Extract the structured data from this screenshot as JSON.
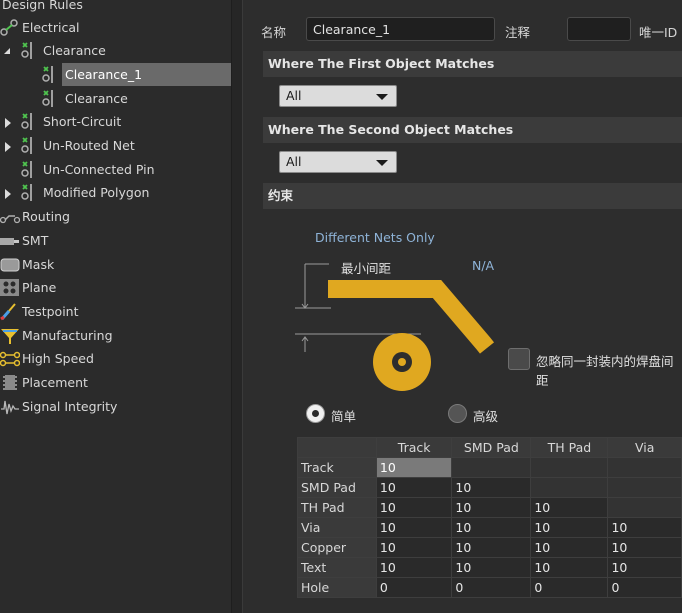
{
  "tree": {
    "root_label": "Design Rules",
    "items": [
      {
        "label": "Electrical",
        "icon": "electrical-rule-icon"
      },
      {
        "label": "Clearance",
        "icon": "clearance-rule-icon",
        "expanded": true
      },
      {
        "label": "Clearance_1",
        "icon": "clearance-rule-icon",
        "selected": true
      },
      {
        "label": "Clearance",
        "icon": "clearance-rule-icon"
      },
      {
        "label": "Short-Circuit",
        "icon": "short-circuit-rule-icon"
      },
      {
        "label": "Un-Routed Net",
        "icon": "unrouted-net-rule-icon"
      },
      {
        "label": "Un-Connected Pin",
        "icon": "unconnected-pin-rule-icon"
      },
      {
        "label": "Modified Polygon",
        "icon": "modified-polygon-rule-icon"
      },
      {
        "label": "Routing",
        "icon": "routing-icon"
      },
      {
        "label": "SMT",
        "icon": "smt-icon"
      },
      {
        "label": "Mask",
        "icon": "mask-icon"
      },
      {
        "label": "Plane",
        "icon": "plane-icon"
      },
      {
        "label": "Testpoint",
        "icon": "testpoint-icon"
      },
      {
        "label": "Manufacturing",
        "icon": "manufacturing-icon"
      },
      {
        "label": "High Speed",
        "icon": "high-speed-icon"
      },
      {
        "label": "Placement",
        "icon": "placement-icon"
      },
      {
        "label": "Signal Integrity",
        "icon": "signal-integrity-icon"
      }
    ]
  },
  "rule": {
    "name_label": "名称",
    "name_value": "Clearance_1",
    "comment_label": "注释",
    "comment_value": "",
    "uid_label": "唯一ID"
  },
  "first_match": {
    "header": "Where The First Object Matches",
    "selected": "All"
  },
  "second_match": {
    "header": "Where The Second Object Matches",
    "selected": "All"
  },
  "constraints": {
    "header": "约束",
    "net_scope": "Different Nets Only",
    "min_clearance_label": "最小间距",
    "min_clearance_value": "N/A",
    "ignore_pads_label": "忽略同一封装内的焊盘间距",
    "mode_simple": "简单",
    "mode_advanced": "高级"
  },
  "matrix": {
    "columns": [
      "Track",
      "SMD Pad",
      "TH Pad",
      "Via"
    ],
    "rows": [
      {
        "name": "Track",
        "values": [
          "10",
          "",
          "",
          ""
        ]
      },
      {
        "name": "SMD Pad",
        "values": [
          "10",
          "10",
          "",
          ""
        ]
      },
      {
        "name": "TH Pad",
        "values": [
          "10",
          "10",
          "10",
          ""
        ]
      },
      {
        "name": "Via",
        "values": [
          "10",
          "10",
          "10",
          "10"
        ]
      },
      {
        "name": "Copper",
        "values": [
          "10",
          "10",
          "10",
          "10"
        ]
      },
      {
        "name": "Text",
        "values": [
          "10",
          "10",
          "10",
          "10"
        ]
      },
      {
        "name": "Hole",
        "values": [
          "0",
          "0",
          "0",
          "0"
        ]
      }
    ]
  },
  "colors": {
    "accent_track": "#e0a820",
    "diagram_text": "#8fb4d8",
    "selection": "#6a6a6a"
  }
}
